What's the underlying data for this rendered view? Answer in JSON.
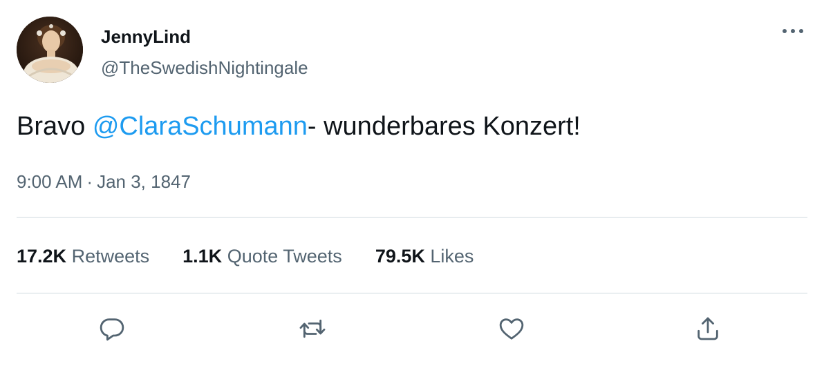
{
  "author": {
    "display_name": "JennyLind",
    "handle": "@TheSwedishNightingale"
  },
  "tweet": {
    "text_before": "Bravo ",
    "mention": "@ClaraSchumann",
    "text_after": "- wunderbares Konzert!",
    "time": "9:00 AM",
    "separator": "·",
    "date": "Jan 3, 1847"
  },
  "stats": {
    "retweets": {
      "count": "17.2K",
      "label": "Retweets"
    },
    "quote_tweets": {
      "count": "1.1K",
      "label": "Quote Tweets"
    },
    "likes": {
      "count": "79.5K",
      "label": "Likes"
    }
  },
  "icons": {
    "more": "more-horizontal-icon",
    "reply": "reply-icon",
    "retweet": "retweet-icon",
    "like": "heart-icon",
    "share": "share-icon"
  },
  "colors": {
    "text": "#0f1419",
    "secondary": "#536471",
    "link": "#1d9bf0",
    "divider": "#cfd9de"
  }
}
